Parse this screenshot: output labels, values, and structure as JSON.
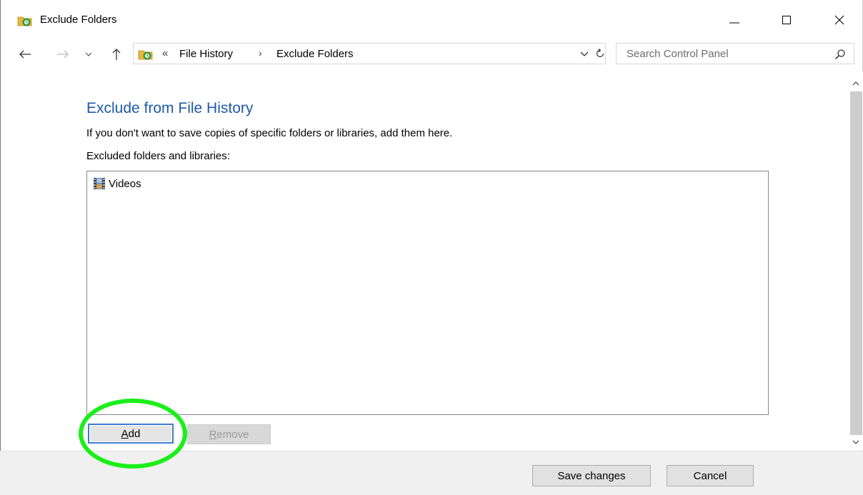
{
  "window": {
    "title": "Exclude Folders",
    "icons": {
      "app": "file-history-icon"
    }
  },
  "navigation": {
    "back": "back-arrow-icon",
    "forward": "forward-arrow-icon",
    "recent": "chevron-down-icon",
    "up": "up-arrow-icon",
    "breadcrumb_prefix": "«",
    "breadcrumbs": [
      "File History",
      "Exclude Folders"
    ],
    "separator": "›"
  },
  "search": {
    "placeholder": "Search Control Panel"
  },
  "main": {
    "heading": "Exclude from File History",
    "description": "If you don't want to save copies of specific folders or libraries, add them here.",
    "list_label": "Excluded folders and libraries:",
    "excluded_items": [
      {
        "label": "Videos",
        "icon": "videos-library-icon"
      }
    ],
    "add_button": {
      "accel": "A",
      "rest": "dd"
    },
    "remove_button": {
      "accel": "R",
      "rest": "emove"
    }
  },
  "footer": {
    "save_label": "Save changes",
    "cancel_label": "Cancel"
  },
  "colors": {
    "heading": "#1e5aa8",
    "highlight_ring": "#1aef1a",
    "focus_border": "#3c7fd1"
  }
}
